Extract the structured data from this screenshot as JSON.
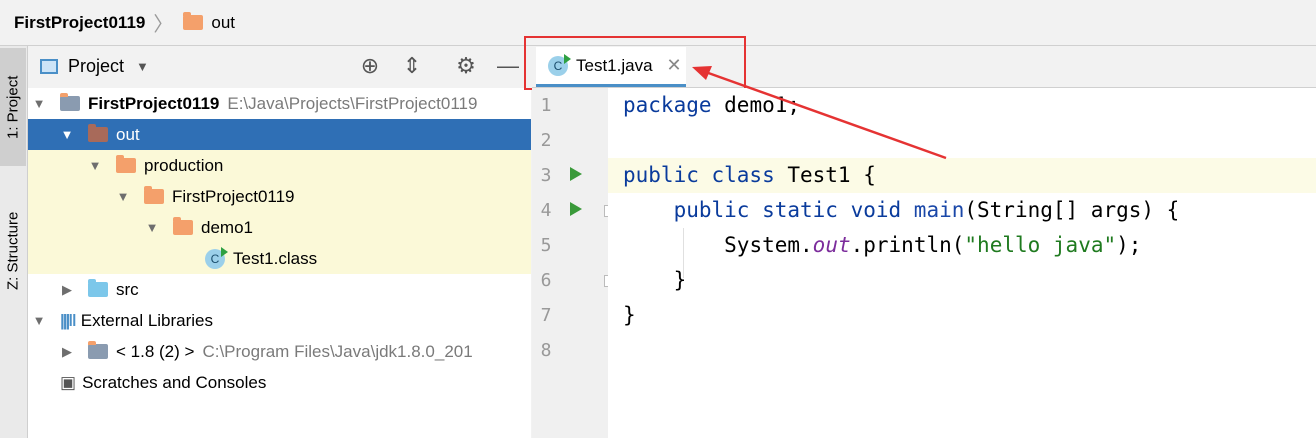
{
  "breadcrumb": {
    "project": "FirstProject0119",
    "folder": "out"
  },
  "sidebar": {
    "project_tab": "1: Project",
    "structure_tab": "Z: Structure"
  },
  "panel": {
    "title": "Project"
  },
  "tree": {
    "root_name": "FirstProject0119",
    "root_path": "E:\\Java\\Projects\\FirstProject0119",
    "out": "out",
    "production": "production",
    "project_dir": "FirstProject0119",
    "package": "demo1",
    "class_file": "Test1.class",
    "src": "src",
    "external_libraries": "External Libraries",
    "jdk_label": "< 1.8 (2) >",
    "jdk_path": "C:\\Program Files\\Java\\jdk1.8.0_201",
    "scratches": "Scratches and Consoles"
  },
  "editor": {
    "tab_title": "Test1.java",
    "line_numbers": [
      "1",
      "2",
      "3",
      "4",
      "5",
      "6",
      "7",
      "8"
    ],
    "code": {
      "l1_kw": "package",
      "l1_rest": " demo1;",
      "l3_kw": "public class",
      "l3_rest": " Test1 {",
      "l4_indent": "    ",
      "l4_kw": "public static void",
      "l4_fn": " main",
      "l4_rest": "(String[] args) {",
      "l5_indent": "        ",
      "l5_a": "System.",
      "l5_out": "out",
      "l5_b": ".println(",
      "l5_str": "\"hello java\"",
      "l5_c": ");",
      "l6": "    }",
      "l7": "}"
    }
  },
  "icons": {
    "class_letter": "C"
  },
  "colors": {
    "selection": "#2f6fb5",
    "annotation": "#e53333",
    "folder": "#f4a06b"
  }
}
